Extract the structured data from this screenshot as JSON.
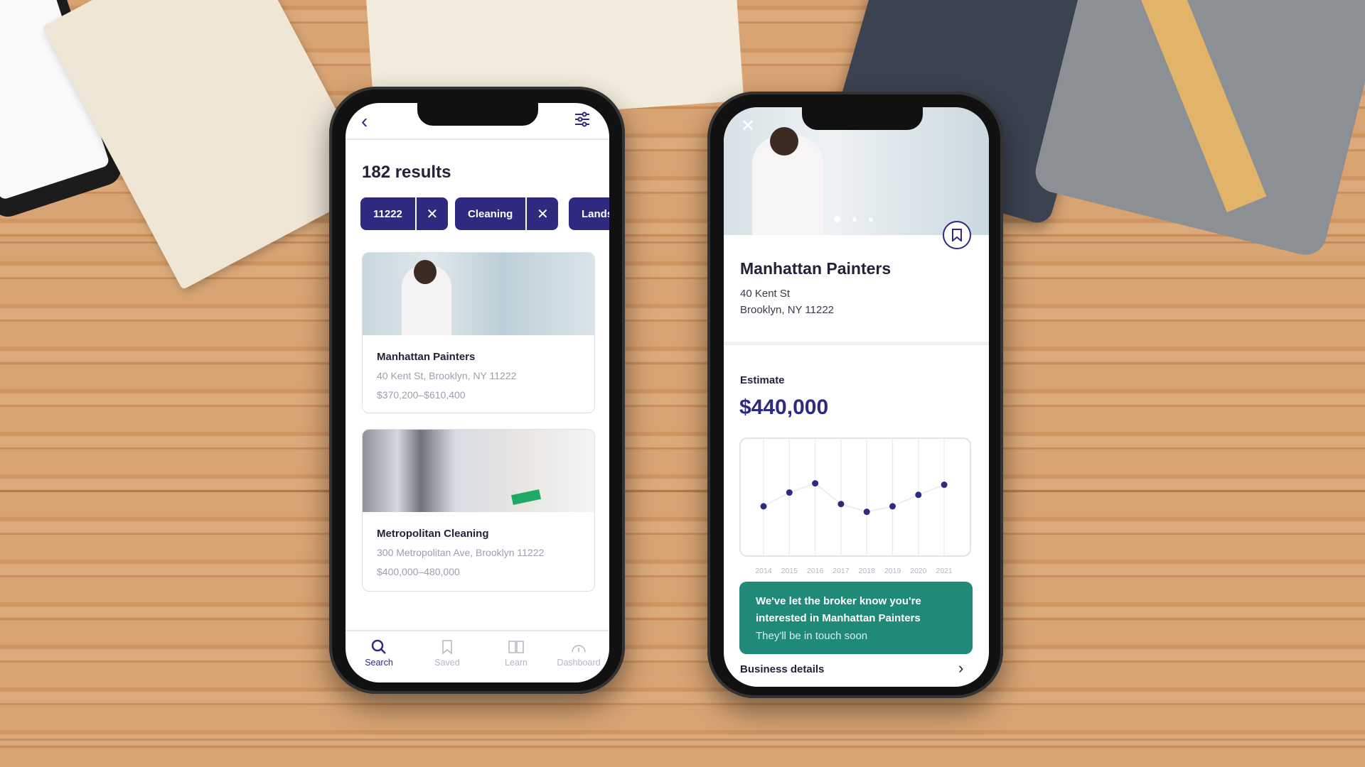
{
  "search_screen": {
    "results_title": "182 results",
    "chips": [
      {
        "label": "11222"
      },
      {
        "label": "Cleaning"
      },
      {
        "label": "Lands"
      }
    ],
    "listings": [
      {
        "name": "Manhattan Painters",
        "address": "40 Kent St, Brooklyn, NY 11222",
        "price_range": "$370,200–$610,400"
      },
      {
        "name": "Metropolitan Cleaning",
        "address": "300 Metropolitan Ave, Brooklyn 11222",
        "price_range": "$400,000–480,000"
      }
    ],
    "bottom_nav": [
      {
        "label": "Search",
        "icon": "search-icon",
        "active": true
      },
      {
        "label": "Saved",
        "icon": "bookmark-icon"
      },
      {
        "label": "Learn",
        "icon": "book-icon"
      },
      {
        "label": "Dashboard",
        "icon": "gauge-icon"
      }
    ]
  },
  "detail_screen": {
    "name": "Manhattan Painters",
    "address_line1": "40 Kent St",
    "address_line2": "Brooklyn, NY 11222",
    "estimate_label": "Estimate",
    "estimate_value": "$440,000",
    "toast_line1": "We've let the broker know you're",
    "toast_line2": "interested in Manhattan Painters",
    "toast_sub": "They'll be in touch soon",
    "business_details": "Business details",
    "carousel_pages": 3,
    "carousel_active": 1
  },
  "colors": {
    "accent": "#2d2a80",
    "toast": "#1f8a78",
    "muted": "#9aa0ae"
  },
  "chart_data": {
    "type": "line",
    "categories": [
      "2014",
      "2015",
      "2016",
      "2017",
      "2018",
      "2019",
      "2020",
      "2021"
    ],
    "values": [
      410,
      440,
      460,
      415,
      398,
      410,
      435,
      457
    ],
    "ylim": [
      300,
      560
    ],
    "grid": "vertical"
  }
}
